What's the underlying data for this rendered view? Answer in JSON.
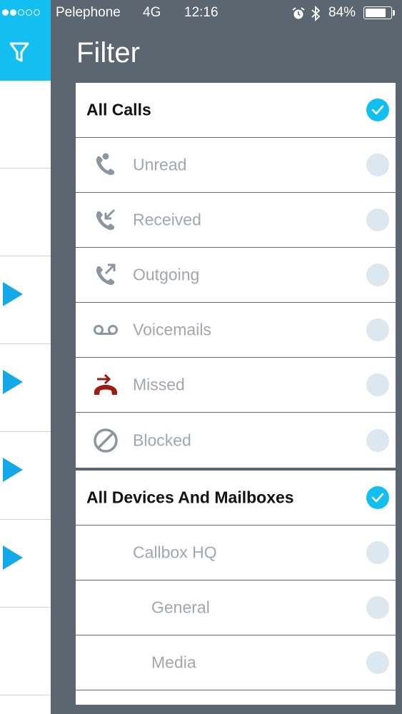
{
  "status_bar": {
    "carrier": "Pelephone",
    "network": "4G",
    "time": "12:16",
    "battery": "84%",
    "battery_level": 0.84,
    "signal_bars": 2,
    "signal_total": 5
  },
  "panel": {
    "title": "Filter"
  },
  "calls_section": {
    "header": "All Calls",
    "header_checked": true,
    "items": [
      {
        "label": "Unread",
        "icon": "phone-unread-icon",
        "checked": false
      },
      {
        "label": "Received",
        "icon": "phone-received-icon",
        "checked": false
      },
      {
        "label": "Outgoing",
        "icon": "phone-outgoing-icon",
        "checked": false
      },
      {
        "label": "Voicemails",
        "icon": "voicemail-icon",
        "checked": false
      },
      {
        "label": "Missed",
        "icon": "phone-missed-icon",
        "checked": false
      },
      {
        "label": "Blocked",
        "icon": "blocked-icon",
        "checked": false
      }
    ]
  },
  "devices_section": {
    "header": "All Devices And Mailboxes",
    "header_checked": true,
    "items": [
      {
        "label": "Callbox HQ",
        "checked": false
      },
      {
        "label": "General",
        "checked": false
      },
      {
        "label": "Media",
        "checked": false
      }
    ]
  },
  "colors": {
    "accent": "#13bff0",
    "overlay": "#5c6670",
    "missed": "#9b1c12",
    "icon_gray": "#8c96a0"
  }
}
